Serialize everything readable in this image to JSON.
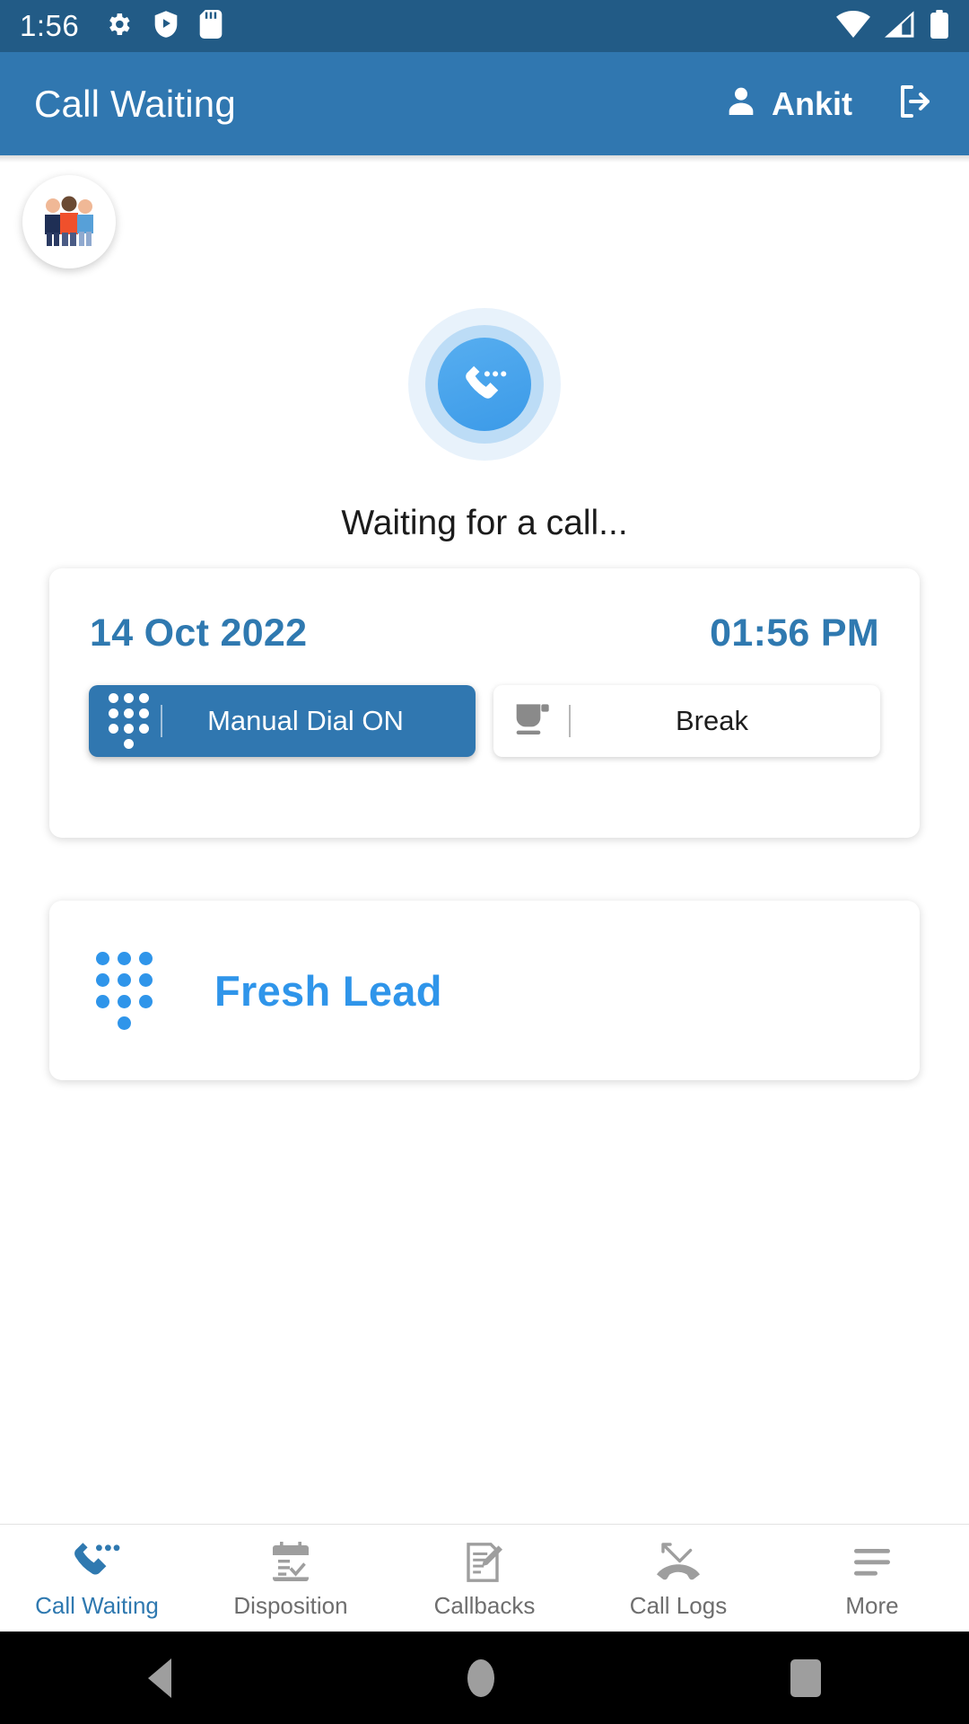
{
  "status_bar": {
    "time": "1:56",
    "left_icons": [
      "gear-icon",
      "shield-play-icon",
      "sd-card-icon"
    ],
    "right_icons": [
      "wifi-icon",
      "cellular-signal-icon",
      "battery-icon"
    ]
  },
  "app_bar": {
    "title": "Call Waiting",
    "user_name": "Ankit",
    "user_icon": "person-icon",
    "logout_icon": "logout-icon"
  },
  "avatar": {
    "icon": "group-of-people-icon"
  },
  "waiting": {
    "icon": "phone-call-waiting-icon",
    "text": "Waiting for a call..."
  },
  "status_card": {
    "date": "14 Oct 2022",
    "time": "01:56 PM",
    "toggles": [
      {
        "label": "Manual Dial ON",
        "icon": "dialpad-icon",
        "state": "on"
      },
      {
        "label": "Break",
        "icon": "coffee-cup-icon",
        "state": "off"
      }
    ]
  },
  "lead_card": {
    "label": "Fresh Lead",
    "icon": "dialpad-icon"
  },
  "bottom_nav": {
    "items": [
      {
        "label": "Call Waiting",
        "icon": "phone-call-waiting-icon",
        "active": true
      },
      {
        "label": "Disposition",
        "icon": "calendar-check-icon",
        "active": false
      },
      {
        "label": "Callbacks",
        "icon": "document-pencil-icon",
        "active": false
      },
      {
        "label": "Call Logs",
        "icon": "missed-call-icon",
        "active": false
      },
      {
        "label": "More",
        "icon": "menu-lines-icon",
        "active": false
      }
    ]
  },
  "android_nav": {
    "back": "back-triangle-icon",
    "home": "home-circle-icon",
    "recents": "recents-square-icon"
  },
  "colors": {
    "status_bar_bg": "#225b86",
    "app_bar_bg": "#3077b0",
    "accent_blue": "#2f79b0",
    "lead_blue": "#2f95ea",
    "page_bg": "#ffffff"
  }
}
